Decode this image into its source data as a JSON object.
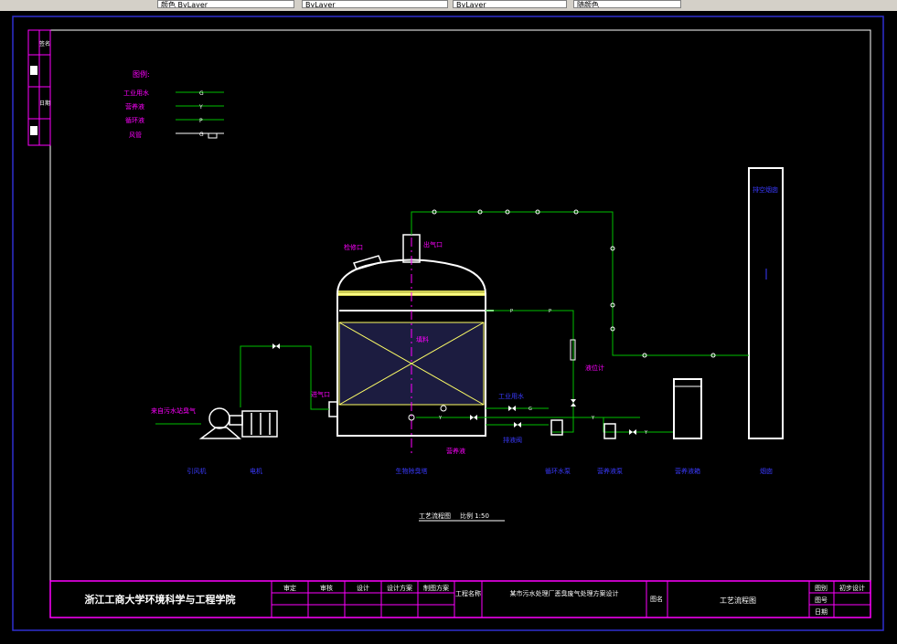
{
  "toolbar": {
    "layer_box": "颜色 ByLayer",
    "linetype_box": "ByLayer",
    "lineweight_box": "ByLayer",
    "plotstyle_box": "随颜色"
  },
  "legend": {
    "title": "图例:",
    "items": [
      {
        "label": "工业用水",
        "symbol": "G"
      },
      {
        "label": "营养液",
        "symbol": "Y"
      },
      {
        "label": "循环液",
        "symbol": "P"
      },
      {
        "label": "风管",
        "symbol": "G"
      }
    ]
  },
  "diagram": {
    "labels": {
      "inlet": "来自污水站臭气",
      "pump_inlet": "进气口",
      "manhole": "检修口",
      "outlet": "出气口",
      "packing": "填料",
      "water_supply": "工业用水",
      "drain_line": "排液阀",
      "nutrient": "营养液",
      "level_gauge": "液位计",
      "chimney": "排空烟囱"
    },
    "equipment": [
      "引风机",
      "电机",
      "生物除臭塔",
      "循环水泵",
      "营养液泵",
      "营养液箱",
      "烟囱"
    ],
    "title": "工艺流程图",
    "scale": "比例 1:50"
  },
  "side_panel": {
    "labels": [
      "签名",
      "日期"
    ]
  },
  "title_block": {
    "institution": "浙江工商大学环境科学与工程学院",
    "roles_top": [
      "审定",
      "审核",
      "设计",
      "设计方案",
      "制图方案"
    ],
    "project_label": "工程名称",
    "project_name": "某市污水处理厂恶臭废气处理方案设计",
    "drawing_label": "图名",
    "drawing_name": "工艺流程图",
    "right_rows": [
      {
        "label": "图别",
        "value": "初步设计"
      },
      {
        "label": "图号",
        "value": ""
      },
      {
        "label": "日期",
        "value": ""
      }
    ]
  },
  "colors": {
    "frame": "#2f2fd0",
    "title_frame": "#ff00ff",
    "pipe": "#00c000",
    "tower": "#ffffff",
    "packing": "#ffff66",
    "axis": "#ff00ff",
    "text_label": "#ff00ff",
    "equip_text": "#3a3aff"
  }
}
